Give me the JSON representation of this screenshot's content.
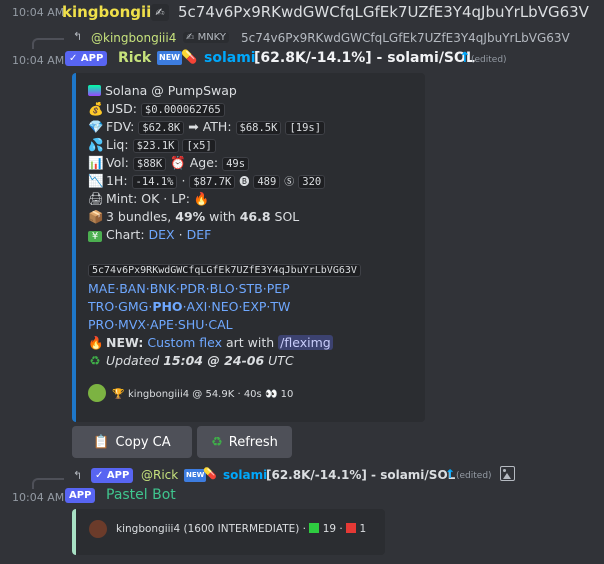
{
  "msg1": {
    "timestamp": "10:04 AM",
    "author": "kingbongiii4",
    "author_icon": "✍",
    "content": "5c74v6Px9RKwdGWCfqLGfEk7UZfE3Y4qJbuYrLbVG63V"
  },
  "reply1": {
    "author": "@kingbongiii4",
    "tag": "MNKY",
    "content": "5c74v6Px9RKwdGWCfqLGfEk7UZfE3Y4qJbuYrLbVG63V"
  },
  "msg2": {
    "timestamp": "10:04 AM",
    "app_badge": "APP",
    "author": "Rick",
    "new_badge": "NEW",
    "token_name": "solami",
    "title_rest": "[62.8K/-14.1%] - solami/SOL",
    "edited": "(edited)",
    "colors": {
      "rick": "#c6e27c",
      "link": "#00a8fc"
    }
  },
  "embed": {
    "platform": "Solana @ PumpSwap",
    "usd_label": "USD:",
    "usd_value": "$0.000062765",
    "fdv_label": "FDV:",
    "fdv_value": "$62.8K",
    "ath_label": "ATH:",
    "ath_value": "$68.5K",
    "ath_age": "[19s]",
    "liq_label": "Liq:",
    "liq_value": "$23.1K",
    "liq_mult": "[x5]",
    "vol_label": "Vol:",
    "vol_value": "$88K",
    "age_label": "Age:",
    "age_value": "49s",
    "h1_label": "1H:",
    "h1_change": "-14.1%",
    "h1_vol": "$87.7K",
    "h1_buys": "489",
    "h1_sells": "320",
    "mint": "Mint: OK · LP:",
    "bundles_a": "3 bundles,",
    "bundles_pct": "49%",
    "bundles_b": "with",
    "bundles_sol": "46.8",
    "bundles_c": "SOL",
    "chart_label": "Chart:",
    "chart_dex": "DEX",
    "chart_sep": "·",
    "chart_def": "DEF",
    "address": "5c74v6Px9RKwdGWCfqLGfEk7UZfE3Y4qJbuYrLbVG63V",
    "links_row1": [
      "MAE",
      "BAN",
      "BNK",
      "PDR",
      "BLO",
      "STB",
      "PEP"
    ],
    "links_row2": [
      "TRO",
      "GMG",
      "PHO",
      "AXI",
      "NEO",
      "EXP",
      "TW"
    ],
    "links_row3": [
      "PRO",
      "MVX",
      "APE",
      "SHU",
      "CAL"
    ],
    "new_label": "NEW:",
    "new_link": "Custom flex",
    "new_text": "art with",
    "new_cmd": "/fleximg",
    "updated_label": "Updated",
    "updated_value": "15:04 @ 24-06",
    "updated_tz": "UTC",
    "footer_text": "kingbongiii4 @ 54.9K · 40s",
    "footer_views": "10"
  },
  "buttons": {
    "copy_label": "Copy CA",
    "refresh_label": "Refresh"
  },
  "reply2": {
    "app_badge": "APP",
    "author": "@Rick",
    "new_badge": "NEW",
    "token_name": "solami",
    "title_rest": "[62.8K/-14.1%] - solami/SOL",
    "edited": "(edited)"
  },
  "msg3": {
    "timestamp": "10:04 AM",
    "app_badge": "APP",
    "author": "Pastel Bot",
    "embed_text": "kingbongiii4 (1600 INTERMEDIATE) ·",
    "green_count": "19",
    "sep": "·",
    "red_count": "1"
  }
}
